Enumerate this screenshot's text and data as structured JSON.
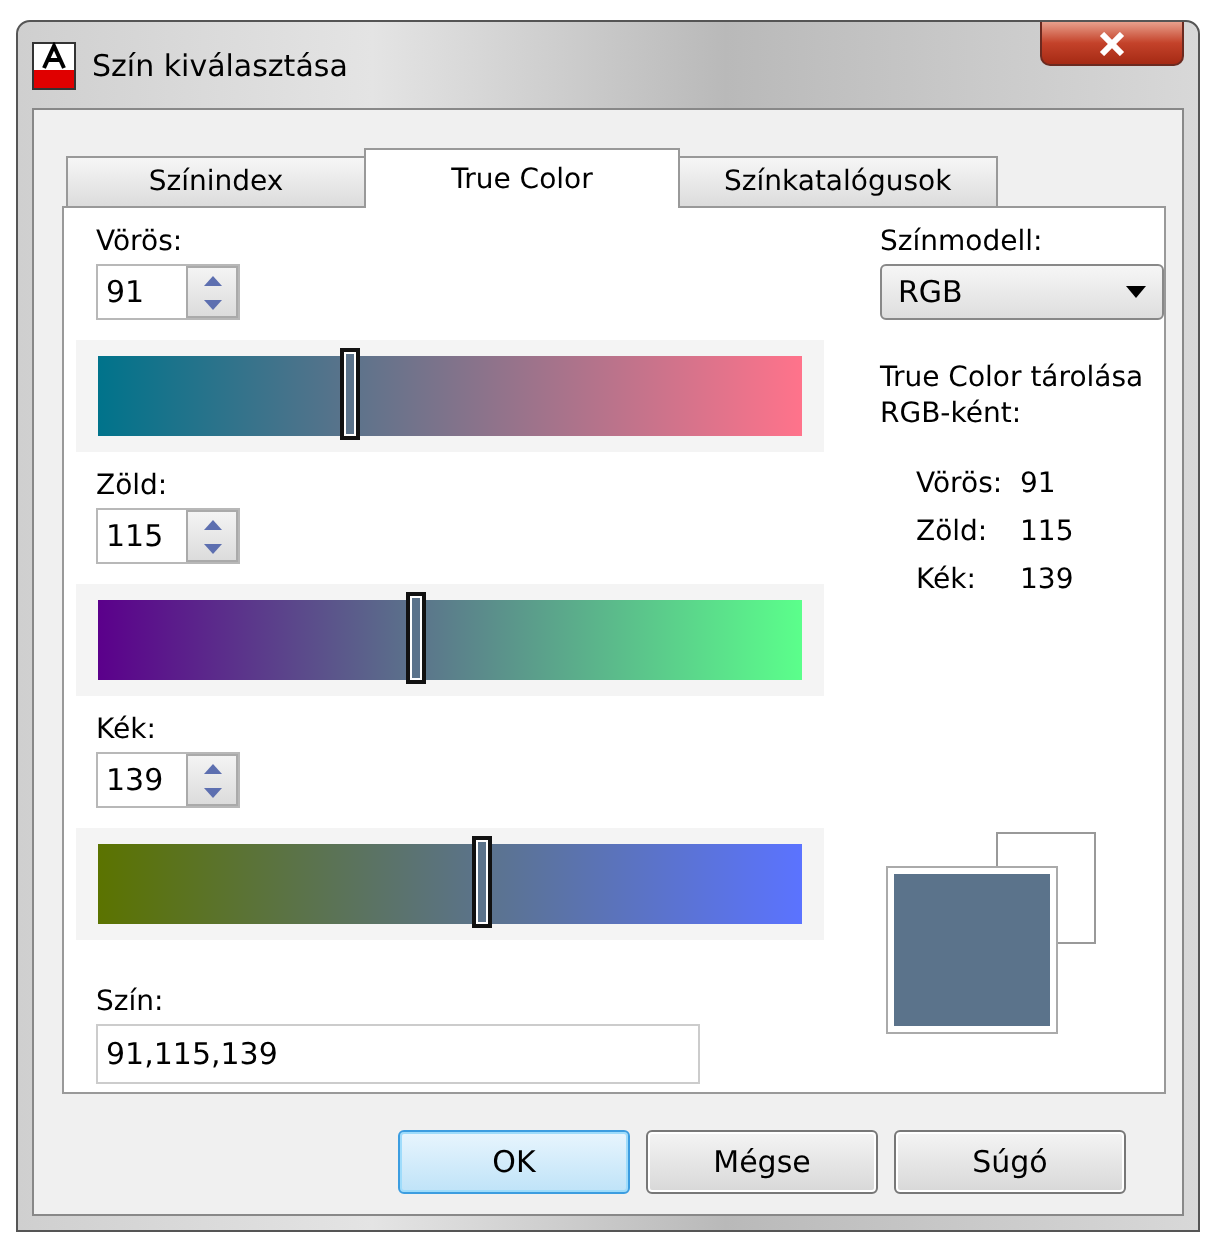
{
  "window": {
    "title": "Szín kiválasztása"
  },
  "tabs": [
    {
      "label": "Színindex",
      "selected": false
    },
    {
      "label": "True Color",
      "selected": true
    },
    {
      "label": "Színkatalógusok",
      "selected": false
    }
  ],
  "channels": [
    {
      "label": "Vörös:",
      "value": "91",
      "level": 0.357
    },
    {
      "label": "Zöld:",
      "value": "115",
      "level": 0.451
    },
    {
      "label": "Kék:",
      "value": "139",
      "level": 0.545
    }
  ],
  "color_field": {
    "label": "Szín:",
    "value": "91,115,139"
  },
  "color_model": {
    "label": "Színmodell:",
    "value": "RGB"
  },
  "storage": {
    "caption": "True Color tárolása RGB-ként:",
    "rows": [
      {
        "name": "Vörös:",
        "value": "91"
      },
      {
        "name": "Zöld:",
        "value": "115"
      },
      {
        "name": "Kék:",
        "value": "139"
      }
    ]
  },
  "buttons": [
    {
      "label": "OK",
      "default": true
    },
    {
      "label": "Mégse",
      "default": false
    },
    {
      "label": "Súgó",
      "default": false
    }
  ]
}
